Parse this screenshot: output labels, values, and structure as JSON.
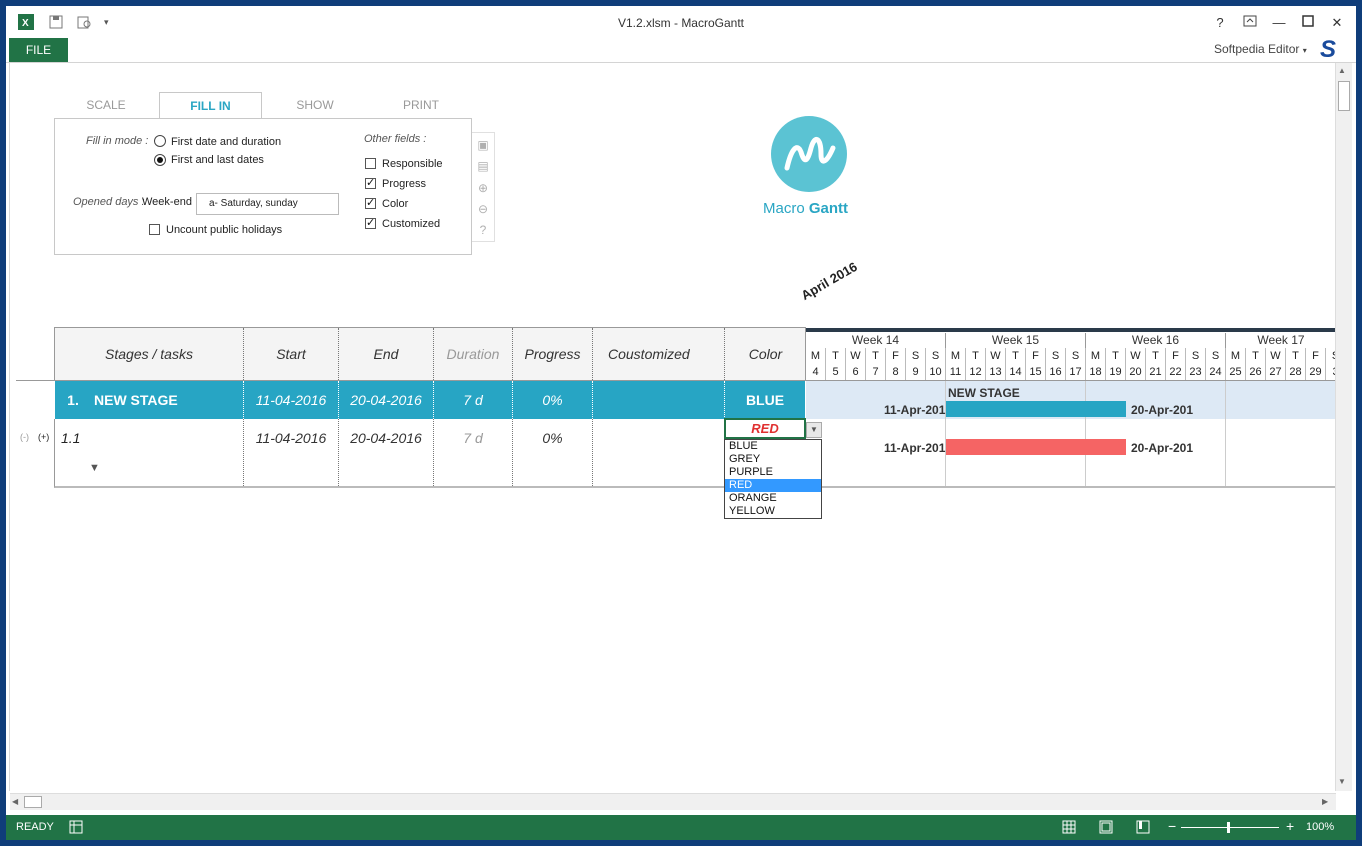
{
  "window": {
    "title": "V1.2.xlsm - MacroGantt",
    "file_tab": "FILE",
    "user": "Softpedia Editor"
  },
  "tabs": [
    "SCALE",
    "FILL IN",
    "SHOW",
    "PRINT"
  ],
  "panel": {
    "fill_mode_label": "Fill in mode :",
    "mode_options": [
      "First date and duration",
      "First and last dates"
    ],
    "selected_mode": "First and last dates",
    "opened_days_label": "Opened days :",
    "weekend_label": "Week-end",
    "weekend_value": "a- Saturday, sunday",
    "uncount_label": "Uncount public holidays",
    "other_fields_label": "Other fields :",
    "fields": [
      {
        "label": "Responsible",
        "checked": false
      },
      {
        "label": "Progress",
        "checked": true
      },
      {
        "label": "Color",
        "checked": true
      },
      {
        "label": "Customized",
        "checked": true
      }
    ]
  },
  "logo": {
    "brand_light": "Macro",
    "brand_bold": "Gantt"
  },
  "month_label": "April 2016",
  "columns": [
    "Stages / tasks",
    "Start",
    "End",
    "Duration",
    "Progress",
    "Coustomized",
    "Color"
  ],
  "stage": {
    "number": "1.",
    "name": "NEW STAGE",
    "start": "11-04-2016",
    "end": "20-04-2016",
    "duration": "7 d",
    "progress": "0%",
    "customized": "",
    "color": "BLUE"
  },
  "task": {
    "collapse": "(-)",
    "expand": "(+)",
    "number": "1.1",
    "start": "11-04-2016",
    "end": "20-04-2016",
    "duration": "7 d",
    "progress": "0%",
    "color": "RED"
  },
  "gantt": {
    "weeks": [
      "Week  14",
      "Week  15",
      "Week  16",
      "Week  17"
    ],
    "day_letters": [
      "M",
      "T",
      "W",
      "T",
      "F",
      "S",
      "S",
      "M",
      "T",
      "W",
      "T",
      "F",
      "S",
      "S",
      "M",
      "T",
      "W",
      "T",
      "F",
      "S",
      "S",
      "M",
      "T",
      "W",
      "T",
      "F",
      "S"
    ],
    "day_numbers": [
      "4",
      "5",
      "6",
      "7",
      "8",
      "9",
      "10",
      "11",
      "12",
      "13",
      "14",
      "15",
      "16",
      "17",
      "18",
      "19",
      "20",
      "21",
      "22",
      "23",
      "24",
      "25",
      "26",
      "27",
      "28",
      "29",
      "3"
    ],
    "stage_bar": {
      "label": "NEW STAGE",
      "start_label": "11-Apr-201",
      "end_label": "20-Apr-201",
      "color": "#27a5c4"
    },
    "task_bar": {
      "start_label": "11-Apr-201",
      "end_label": "20-Apr-201",
      "color": "#f56464"
    }
  },
  "dropdown": {
    "options": [
      "BLUE",
      "GREY",
      "PURPLE",
      "RED",
      "ORANGE",
      "YELLOW"
    ],
    "selected": "RED"
  },
  "status": {
    "ready": "READY",
    "zoom": "100%"
  },
  "colors": {
    "excel_green": "#217346",
    "accent": "#27a5c4",
    "red": "#f56464"
  }
}
